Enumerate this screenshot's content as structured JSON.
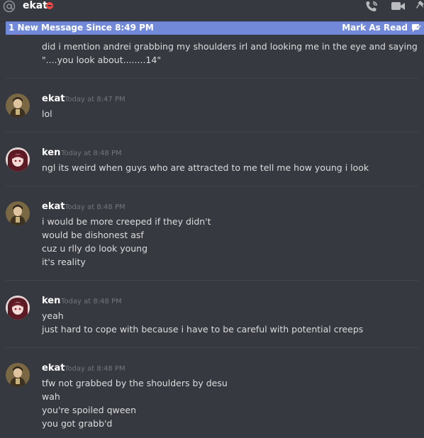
{
  "header": {
    "channel_name": "ekat",
    "icons": [
      "at-icon",
      "dnd-status-icon",
      "phone-call-icon",
      "video-call-icon",
      "pin-icon"
    ]
  },
  "new_messages_bar": {
    "text": "1 New Message Since 8:49 PM",
    "mark_read": "Mark As Read"
  },
  "messages": [
    {
      "author": "",
      "timestamp": "",
      "lines": [
        "did i mention andrei grabbing my shoulders irl and looking me in the eye and saying",
        "\"....you look about........14\""
      ]
    },
    {
      "author": "ekat",
      "timestamp": "Today at 8:47 PM",
      "lines": [
        "lol"
      ]
    },
    {
      "author": "ken",
      "timestamp": "Today at 8:48 PM",
      "lines": [
        "ngl its weird when guys who are attracted to me tell me how young i look"
      ]
    },
    {
      "author": "ekat",
      "timestamp": "Today at 8:48 PM",
      "lines": [
        "i would be more creeped if they didn't",
        "would be dishonest asf",
        "cuz u rlly do look young",
        "it's reality"
      ]
    },
    {
      "author": "ken",
      "timestamp": "Today at 8:48 PM",
      "lines": [
        "yeah",
        "just hard to cope with because i have to be careful with potential creeps"
      ]
    },
    {
      "author": "ekat",
      "timestamp": "Today at 8:48 PM",
      "lines": [
        "tfw not grabbed by the shoulders by desu",
        "wah",
        "you're spoiled qween",
        "you got grabb'd"
      ]
    }
  ],
  "colors": {
    "background": "#36393f",
    "accent": "#7289da",
    "dnd": "#f04747",
    "text": "#dcddde",
    "timestamp": "#72767d"
  }
}
